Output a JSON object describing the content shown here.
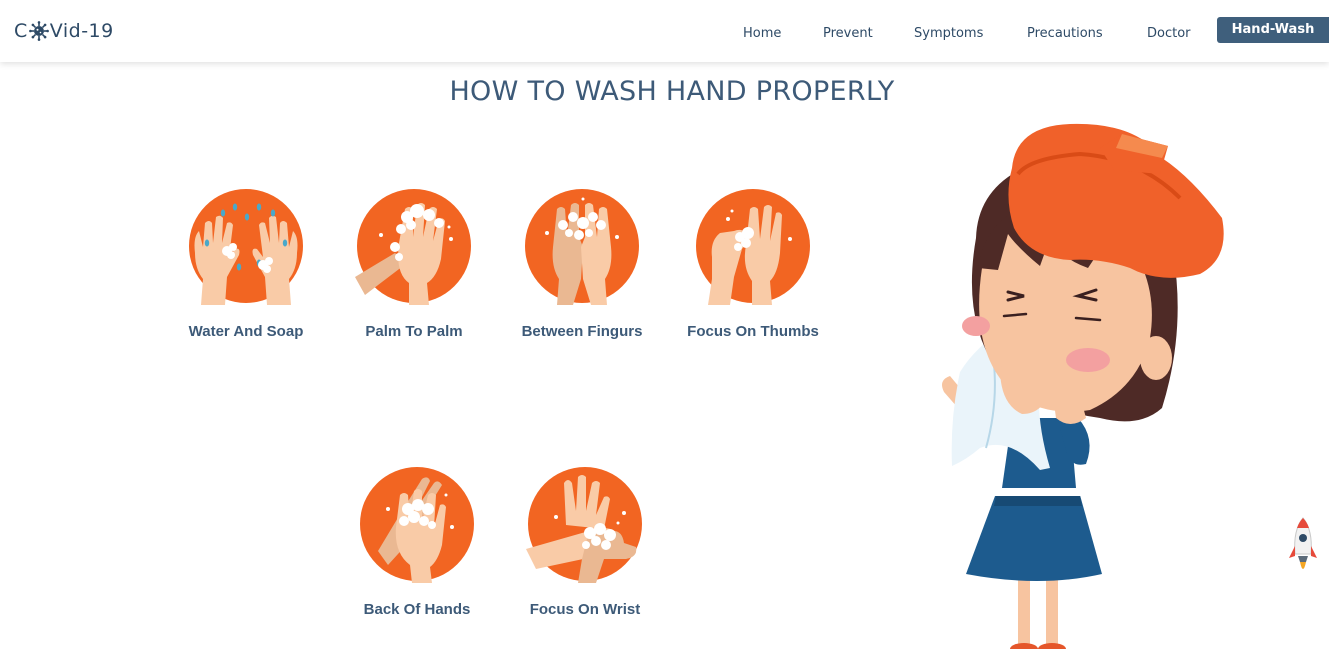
{
  "brand": {
    "prefix": "C",
    "suffix": "Vid-19",
    "icon": "virus-icon"
  },
  "nav": {
    "items": [
      {
        "label": "Home"
      },
      {
        "label": "Prevent"
      },
      {
        "label": "Symptoms"
      },
      {
        "label": "Precautions"
      },
      {
        "label": "Doctor"
      },
      {
        "label": "Hand-Wash",
        "active": true
      }
    ]
  },
  "page": {
    "title": "HOW TO WASH HAND PROPERLY"
  },
  "steps": [
    {
      "label": "Water And Soap",
      "icon": "water-and-soap-icon"
    },
    {
      "label": "Palm To Palm",
      "icon": "palm-to-palm-icon"
    },
    {
      "label": "Between Fingurs",
      "icon": "between-fingers-icon"
    },
    {
      "label": "Focus On Thumbs",
      "icon": "focus-on-thumbs-icon"
    },
    {
      "label": "Back Of Hands",
      "icon": "back-of-hands-icon"
    },
    {
      "label": "Focus On Wrist",
      "icon": "focus-on-wrist-icon"
    }
  ],
  "illustration": {
    "icon": "sick-girl-illustration"
  },
  "scroll_top": {
    "icon": "rocket-icon"
  },
  "colors": {
    "accent": "#3f5f7c",
    "text": "#3d5a78",
    "circle": "#f26522",
    "skin": "#f9cba7",
    "foam": "#ffffff"
  }
}
